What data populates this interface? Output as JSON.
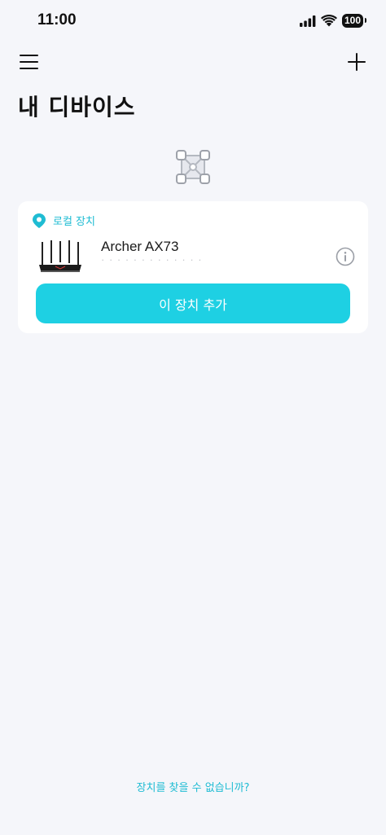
{
  "status_bar": {
    "time": "11:00",
    "battery": "100"
  },
  "header": {
    "title": "내 디바이스",
    "menu_icon": "hamburger-menu-icon",
    "add_icon": "plus-icon"
  },
  "empty_illustration": "satellite-router-icon",
  "local_devices": {
    "section_label": "로컬 장치",
    "section_icon": "location-pin-icon",
    "device": {
      "name": "Archer AX73",
      "image": "router-image",
      "info_icon": "info-icon"
    },
    "add_button_label": "이 장치 추가"
  },
  "footer": {
    "cant_find_label": "장치를 찾을 수 없습니까?"
  },
  "colors": {
    "accent": "#1ed0e3",
    "accent_text": "#1fbcd3",
    "background": "#f5f6fa",
    "card": "#ffffff"
  }
}
